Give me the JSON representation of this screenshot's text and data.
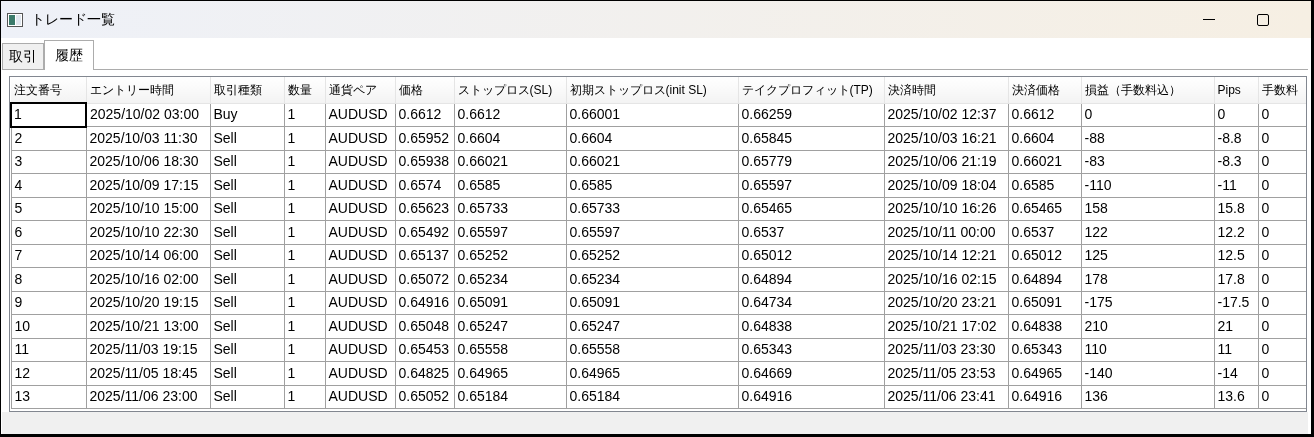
{
  "window": {
    "title": "トレード一覧"
  },
  "tabs": [
    {
      "label": "取引",
      "selected": false
    },
    {
      "label": "履歴",
      "selected": true
    }
  ],
  "table": {
    "columns": [
      "注文番号",
      "エントリー時間",
      "取引種類",
      "数量",
      "通貨ペア",
      "価格",
      "ストップロス(SL)",
      "初期ストップロス(init SL)",
      "テイクプロフィット(TP)",
      "決済時間",
      "決済価格",
      "損益（手数料込）",
      "Pips",
      "手数料"
    ],
    "rows": [
      {
        "current": true,
        "cells": [
          "1",
          "2025/10/02 03:00",
          "Buy",
          "1",
          "AUDUSD",
          "0.6612",
          "0.6612",
          "0.66001",
          "0.66259",
          "2025/10/02 12:37",
          "0.6612",
          "0",
          "0",
          "0"
        ]
      },
      {
        "current": false,
        "cells": [
          "2",
          "2025/10/03 11:30",
          "Sell",
          "1",
          "AUDUSD",
          "0.65952",
          "0.6604",
          "0.6604",
          "0.65845",
          "2025/10/03 16:21",
          "0.6604",
          "-88",
          "-8.8",
          "0"
        ]
      },
      {
        "current": false,
        "cells": [
          "3",
          "2025/10/06 18:30",
          "Sell",
          "1",
          "AUDUSD",
          "0.65938",
          "0.66021",
          "0.66021",
          "0.65779",
          "2025/10/06 21:19",
          "0.66021",
          "-83",
          "-8.3",
          "0"
        ]
      },
      {
        "current": false,
        "cells": [
          "4",
          "2025/10/09 17:15",
          "Sell",
          "1",
          "AUDUSD",
          "0.6574",
          "0.6585",
          "0.6585",
          "0.65597",
          "2025/10/09 18:04",
          "0.6585",
          "-110",
          "-11",
          "0"
        ]
      },
      {
        "current": false,
        "cells": [
          "5",
          "2025/10/10 15:00",
          "Sell",
          "1",
          "AUDUSD",
          "0.65623",
          "0.65733",
          "0.65733",
          "0.65465",
          "2025/10/10 16:26",
          "0.65465",
          "158",
          "15.8",
          "0"
        ]
      },
      {
        "current": false,
        "cells": [
          "6",
          "2025/10/10 22:30",
          "Sell",
          "1",
          "AUDUSD",
          "0.65492",
          "0.65597",
          "0.65597",
          "0.6537",
          "2025/10/11 00:00",
          "0.6537",
          "122",
          "12.2",
          "0"
        ]
      },
      {
        "current": false,
        "cells": [
          "7",
          "2025/10/14 06:00",
          "Sell",
          "1",
          "AUDUSD",
          "0.65137",
          "0.65252",
          "0.65252",
          "0.65012",
          "2025/10/14 12:21",
          "0.65012",
          "125",
          "12.5",
          "0"
        ]
      },
      {
        "current": false,
        "cells": [
          "8",
          "2025/10/16 02:00",
          "Sell",
          "1",
          "AUDUSD",
          "0.65072",
          "0.65234",
          "0.65234",
          "0.64894",
          "2025/10/16 02:15",
          "0.64894",
          "178",
          "17.8",
          "0"
        ]
      },
      {
        "current": false,
        "cells": [
          "9",
          "2025/10/20 19:15",
          "Sell",
          "1",
          "AUDUSD",
          "0.64916",
          "0.65091",
          "0.65091",
          "0.64734",
          "2025/10/20 23:21",
          "0.65091",
          "-175",
          "-17.5",
          "0"
        ]
      },
      {
        "current": false,
        "cells": [
          "10",
          "2025/10/21 13:00",
          "Sell",
          "1",
          "AUDUSD",
          "0.65048",
          "0.65247",
          "0.65247",
          "0.64838",
          "2025/10/21 17:02",
          "0.64838",
          "210",
          "21",
          "0"
        ]
      },
      {
        "current": false,
        "cells": [
          "11",
          "2025/11/03 19:15",
          "Sell",
          "1",
          "AUDUSD",
          "0.65453",
          "0.65558",
          "0.65558",
          "0.65343",
          "2025/11/03 23:30",
          "0.65343",
          "110",
          "11",
          "0"
        ]
      },
      {
        "current": false,
        "cells": [
          "12",
          "2025/11/05 18:45",
          "Sell",
          "1",
          "AUDUSD",
          "0.64825",
          "0.64965",
          "0.64965",
          "0.64669",
          "2025/11/05 23:53",
          "0.64965",
          "-140",
          "-14",
          "0"
        ]
      },
      {
        "current": false,
        "cells": [
          "13",
          "2025/11/06 23:00",
          "Sell",
          "1",
          "AUDUSD",
          "0.65052",
          "0.65184",
          "0.65184",
          "0.64916",
          "2025/11/06 23:41",
          "0.64916",
          "136",
          "13.6",
          "0"
        ]
      }
    ]
  }
}
